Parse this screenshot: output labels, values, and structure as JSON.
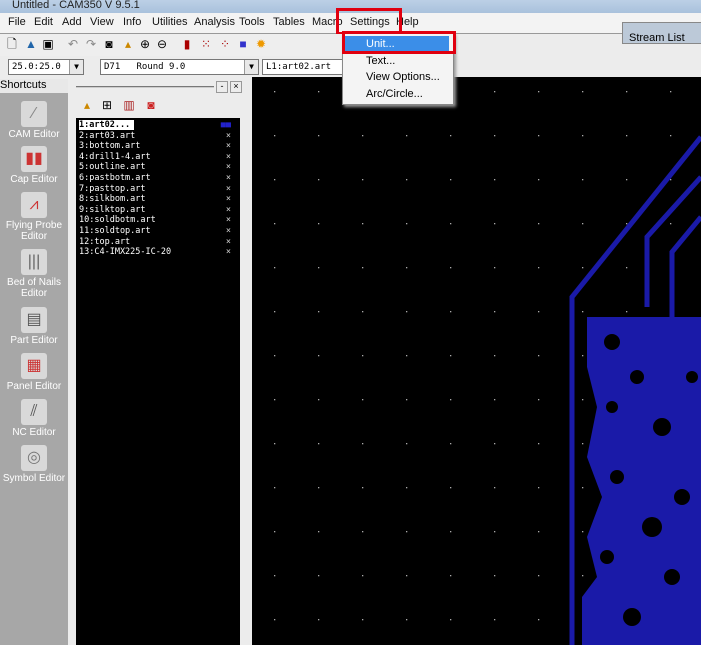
{
  "window": {
    "title": "Untitled - CAM350 V 9.5.1"
  },
  "menu": [
    "File",
    "Edit",
    "Add",
    "View",
    "Info",
    "Utilities",
    "Analysis",
    "Tools",
    "Tables",
    "Macro",
    "Settings",
    "Help"
  ],
  "settings_menu": {
    "items": [
      "Unit...",
      "Text...",
      "View Options...",
      "Arc/Circle..."
    ],
    "highlighted": "Unit..."
  },
  "toolbar_icons": [
    "new-icon",
    "open-icon",
    "save-icon",
    "undo-icon",
    "redo-icon",
    "camera-icon",
    "brush-icon",
    "zoom-in-icon",
    "zoom-out-icon",
    "insert-icon",
    "grid-icon",
    "grid-dots-icon",
    "color-icon",
    "light-icon"
  ],
  "combos": {
    "grid": "25.0:25.0",
    "dcode": "D71   Round 9.0",
    "layer": "L1:art02.art"
  },
  "stream_list": "Stream List",
  "shortcuts": {
    "title": "Shortcuts",
    "items": [
      "CAM Editor",
      "Cap Editor",
      "Flying Probe Editor",
      "Bed of Nails Editor",
      "Part Editor",
      "Panel Editor",
      "NC Editor",
      "Symbol Editor"
    ]
  },
  "layers": [
    "1:art02...",
    "2:art03.art",
    "3:bottom.art",
    "4:drill1-4.art",
    "5:outline.art",
    "6:pastbotm.art",
    "7:pasttop.art",
    "8:silkbom.art",
    "9:silktop.art",
    "10:soldbotm.art",
    "11:soldtop.art",
    "12:top.art",
    "13:C4-IMX225-IC-20"
  ],
  "colors": {
    "accent": "#3b8ee8",
    "highlight": "#e00010",
    "trace": "#1a1aa8"
  }
}
